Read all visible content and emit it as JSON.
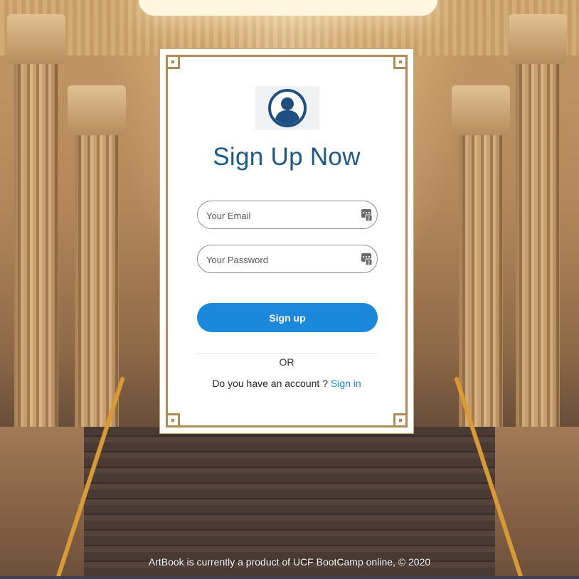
{
  "card": {
    "title": "Sign Up Now",
    "avatar_icon": "user-avatar-icon",
    "email": {
      "placeholder": "Your Email",
      "value": "",
      "icon": "password-manager-key-icon"
    },
    "password": {
      "placeholder": "Your Password",
      "value": "",
      "icon": "password-manager-key-icon"
    },
    "signup_label": "Sign up",
    "or_label": "OR",
    "account_prompt": "Do you have an account ?",
    "signin_label": "Sign in"
  },
  "footer": {
    "text": "ArtBook is currently a product of UCF BootCamp online, © 2020"
  },
  "colors": {
    "title": "#1b5a86",
    "button": "#1c88dc",
    "link": "#1b86c8",
    "frame": "#b08b53"
  }
}
